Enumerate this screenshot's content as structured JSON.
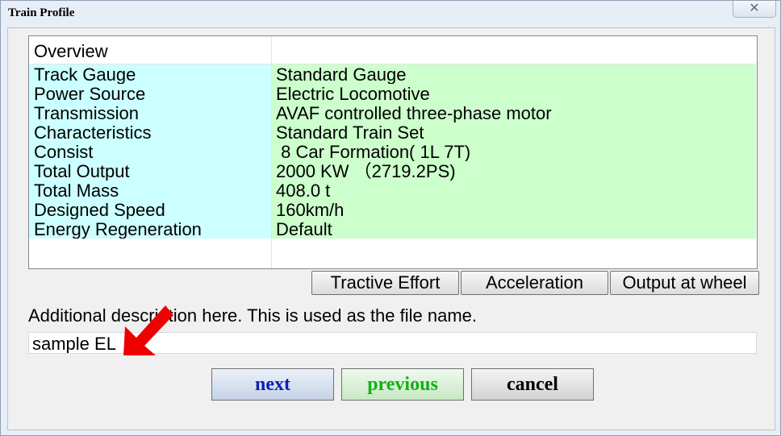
{
  "window": {
    "title": "Train Profile",
    "close_glyph": "✕"
  },
  "grid": {
    "header": "Overview",
    "rows": [
      {
        "key": "Track Gauge",
        "value": "Standard Gauge"
      },
      {
        "key": "Power Source",
        "value": "Electric Locomotive"
      },
      {
        "key": "Transmission",
        "value": "AVAF controlled three-phase motor"
      },
      {
        "key": "Characteristics",
        "value": "Standard Train Set"
      },
      {
        "key": "Consist",
        "value": " 8 Car Formation( 1L 7T)"
      },
      {
        "key": "Total Output",
        "value": "2000 KW （2719.2PS)"
      },
      {
        "key": "Total Mass",
        "value": "408.0 t"
      },
      {
        "key": "Designed Speed",
        "value": "160km/h"
      },
      {
        "key": "Energy Regeneration",
        "value": "Default"
      }
    ]
  },
  "graph_buttons": {
    "tractive_effort": "Tractive Effort",
    "acceleration": "Acceleration",
    "output_at_wheel": "Output at wheel"
  },
  "description": {
    "label": "Additional description here. This is used as the file name.",
    "value": "sample EL"
  },
  "nav": {
    "next": "next",
    "previous": "previous",
    "cancel": "cancel"
  },
  "colors": {
    "key_bg": "#ccffff",
    "value_bg": "#ccffcc",
    "next_text": "#0b1fb5",
    "previous_text": "#11b211",
    "arrow": "#ee0000"
  },
  "icons": {
    "close": "close-icon",
    "pointer": "red-arrow-icon"
  }
}
